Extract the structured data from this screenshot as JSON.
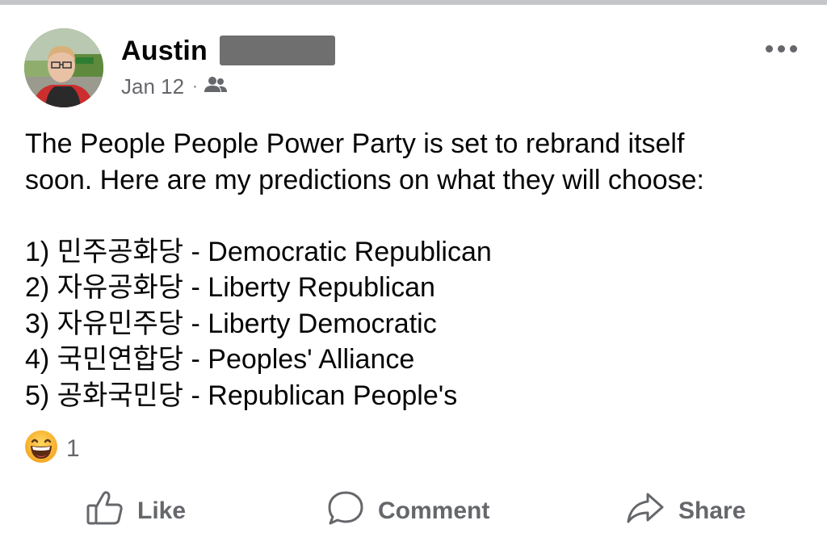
{
  "post": {
    "author_name": "Austin",
    "timestamp": "Jan 12",
    "separator": "·",
    "audience_icon": "friends-icon",
    "more_icon": "more-options-icon",
    "lines": [
      "The People People Power Party is set to rebrand itself",
      "soon. Here are my predictions on what they will choose:",
      "",
      "1) 민주공화당 - Democratic Republican",
      "2) 자유공화당 - Liberty Republican",
      "3) 자유민주당 - Liberty Democratic",
      "4) 국민연합당 - Peoples' Alliance",
      "5) 공화국민당 - Republican People's"
    ]
  },
  "reactions": {
    "emoji_icon": "laughing-emoji-icon",
    "count": "1"
  },
  "actions": {
    "like_label": "Like",
    "comment_label": "Comment",
    "share_label": "Share"
  },
  "colors": {
    "text": "#050505",
    "secondary": "#65676b",
    "redaction": "#6f6f6f"
  }
}
